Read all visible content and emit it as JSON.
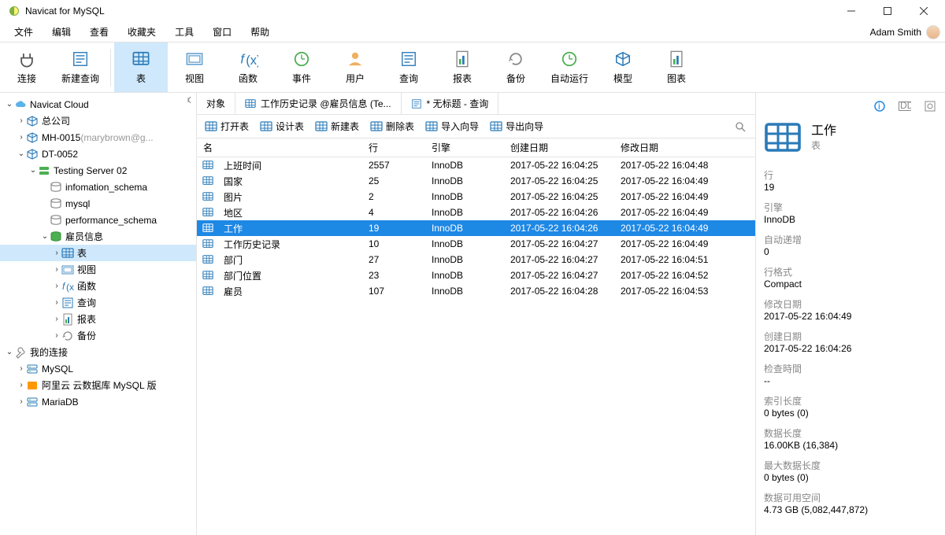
{
  "window": {
    "title": "Navicat for MySQL"
  },
  "menubar": {
    "items": [
      "文件",
      "编辑",
      "查看",
      "收藏夹",
      "工具",
      "窗口",
      "帮助"
    ],
    "user": "Adam Smith"
  },
  "toolbar": {
    "items": [
      {
        "label": "连接",
        "icon": "plug"
      },
      {
        "label": "新建查询",
        "icon": "newquery"
      },
      {
        "label": "表",
        "icon": "table",
        "selected": true
      },
      {
        "label": "视图",
        "icon": "view"
      },
      {
        "label": "函数",
        "icon": "fx"
      },
      {
        "label": "事件",
        "icon": "clock"
      },
      {
        "label": "用户",
        "icon": "user"
      },
      {
        "label": "查询",
        "icon": "query"
      },
      {
        "label": "报表",
        "icon": "report"
      },
      {
        "label": "备份",
        "icon": "backup"
      },
      {
        "label": "自动运行",
        "icon": "auto"
      },
      {
        "label": "模型",
        "icon": "model"
      },
      {
        "label": "图表",
        "icon": "chart"
      }
    ]
  },
  "sidebar": {
    "cloud_label": "Navicat Cloud",
    "cloud_children": [
      {
        "label": "总公司",
        "icon": "cube"
      },
      {
        "label": "MH-0015",
        "icon": "cube",
        "suffix": "(marybrown@g..."
      },
      {
        "label": "DT-0052",
        "icon": "cube",
        "expanded": true,
        "children": [
          {
            "label": "Testing Server 02",
            "icon": "server",
            "green": true,
            "expanded": true,
            "children": [
              {
                "label": "infomation_schema",
                "icon": "db"
              },
              {
                "label": "mysql",
                "icon": "db"
              },
              {
                "label": "performance_schema",
                "icon": "db"
              },
              {
                "label": "雇员信息",
                "icon": "db",
                "expanded": true,
                "children": [
                  {
                    "label": "表",
                    "icon": "table",
                    "selected": true
                  },
                  {
                    "label": "视图",
                    "icon": "view"
                  },
                  {
                    "label": "函数",
                    "icon": "fx"
                  },
                  {
                    "label": "查询",
                    "icon": "query"
                  },
                  {
                    "label": "报表",
                    "icon": "report"
                  },
                  {
                    "label": "备份",
                    "icon": "backup"
                  }
                ]
              }
            ]
          }
        ]
      }
    ],
    "local_label": "我的连接",
    "local_children": [
      {
        "label": "MySQL",
        "icon": "server"
      },
      {
        "label": "阿里云 云数据库 MySQL 版",
        "icon": "server-orange"
      },
      {
        "label": "MariaDB",
        "icon": "server"
      }
    ]
  },
  "tabs": [
    {
      "label": "对象",
      "active": true
    },
    {
      "label": "工作历史记录 @雇员信息 (Te...",
      "icon": "table"
    },
    {
      "label": "* 无标题 - 查询",
      "icon": "query"
    }
  ],
  "subtoolbar": [
    {
      "label": "打开表",
      "icon": "open"
    },
    {
      "label": "设计表",
      "icon": "design"
    },
    {
      "label": "新建表",
      "icon": "new"
    },
    {
      "label": "删除表",
      "icon": "delete"
    },
    {
      "label": "导入向导",
      "icon": "import"
    },
    {
      "label": "导出向导",
      "icon": "export"
    }
  ],
  "grid": {
    "columns": [
      "名",
      "行",
      "引擎",
      "创建日期",
      "修改日期"
    ],
    "rows": [
      {
        "name": "上班时间",
        "rows": "2557",
        "engine": "InnoDB",
        "cdate": "2017-05-22 16:04:25",
        "mdate": "2017-05-22 16:04:48"
      },
      {
        "name": "国家",
        "rows": "25",
        "engine": "InnoDB",
        "cdate": "2017-05-22 16:04:25",
        "mdate": "2017-05-22 16:04:49"
      },
      {
        "name": "图片",
        "rows": "2",
        "engine": "InnoDB",
        "cdate": "2017-05-22 16:04:25",
        "mdate": "2017-05-22 16:04:49"
      },
      {
        "name": "地区",
        "rows": "4",
        "engine": "InnoDB",
        "cdate": "2017-05-22 16:04:26",
        "mdate": "2017-05-22 16:04:49"
      },
      {
        "name": "工作",
        "rows": "19",
        "engine": "InnoDB",
        "cdate": "2017-05-22 16:04:26",
        "mdate": "2017-05-22 16:04:49",
        "selected": true
      },
      {
        "name": "工作历史记录",
        "rows": "10",
        "engine": "InnoDB",
        "cdate": "2017-05-22 16:04:27",
        "mdate": "2017-05-22 16:04:49"
      },
      {
        "name": "部门",
        "rows": "27",
        "engine": "InnoDB",
        "cdate": "2017-05-22 16:04:27",
        "mdate": "2017-05-22 16:04:51"
      },
      {
        "name": "部门位置",
        "rows": "23",
        "engine": "InnoDB",
        "cdate": "2017-05-22 16:04:27",
        "mdate": "2017-05-22 16:04:52"
      },
      {
        "name": "雇员",
        "rows": "107",
        "engine": "InnoDB",
        "cdate": "2017-05-22 16:04:28",
        "mdate": "2017-05-22 16:04:53"
      }
    ]
  },
  "info": {
    "title": "工作",
    "subtitle": "表",
    "props": [
      {
        "k": "行",
        "v": "19"
      },
      {
        "k": "引擎",
        "v": "InnoDB"
      },
      {
        "k": "自动递增",
        "v": "0"
      },
      {
        "k": "行格式",
        "v": "Compact"
      },
      {
        "k": "修改日期",
        "v": "2017-05-22 16:04:49"
      },
      {
        "k": "创建日期",
        "v": "2017-05-22 16:04:26"
      },
      {
        "k": "检查時間",
        "v": "--"
      },
      {
        "k": "索引长度",
        "v": "0 bytes (0)"
      },
      {
        "k": "数据长度",
        "v": "16.00KB (16,384)"
      },
      {
        "k": "最大数据长度",
        "v": "0 bytes (0)"
      },
      {
        "k": "数据可用空间",
        "v": "4.73 GB (5,082,447,872)"
      }
    ]
  }
}
